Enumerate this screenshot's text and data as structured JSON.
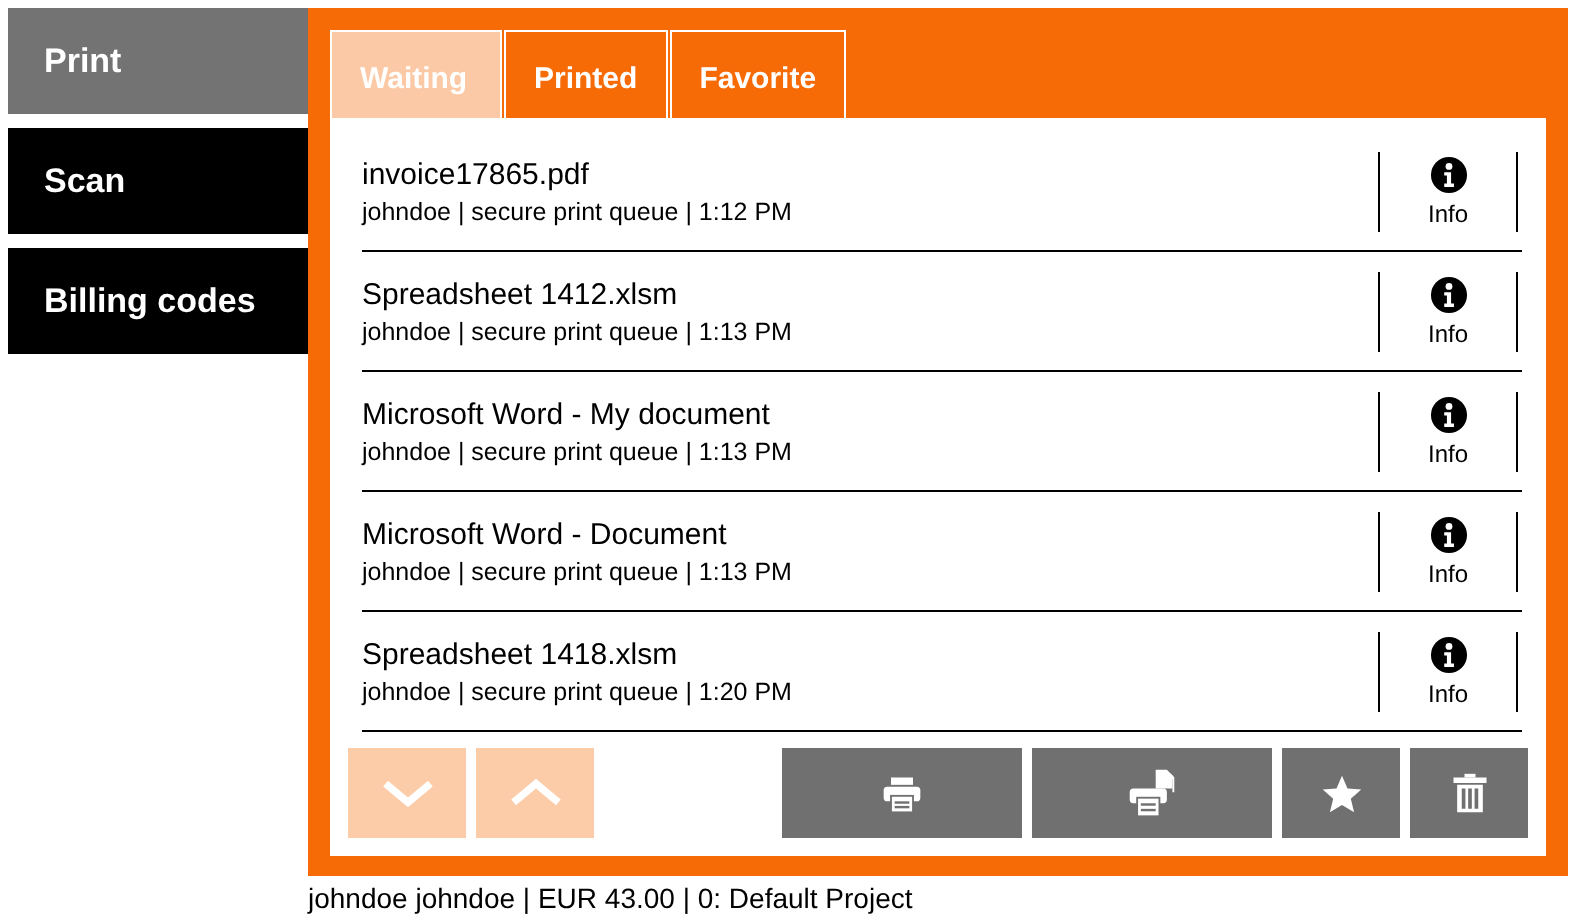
{
  "sidebar": {
    "items": [
      {
        "label": "Print",
        "selected": true
      },
      {
        "label": "Scan",
        "selected": false
      },
      {
        "label": "Billing codes",
        "selected": false
      }
    ]
  },
  "tabs": [
    {
      "label": "Waiting",
      "selected": true
    },
    {
      "label": "Printed",
      "selected": false
    },
    {
      "label": "Favorite",
      "selected": false
    }
  ],
  "jobs": [
    {
      "name": "invoice17865.pdf",
      "details": "johndoe | secure print queue | 1:12 PM",
      "action": "Info"
    },
    {
      "name": "Spreadsheet 1412.xlsm",
      "details": "johndoe | secure print queue | 1:13 PM",
      "action": "Info"
    },
    {
      "name": "Microsoft Word - My document",
      "details": "johndoe | secure print queue | 1:13 PM",
      "action": "Info"
    },
    {
      "name": "Microsoft Word - Document",
      "details": "johndoe | secure print queue | 1:13 PM",
      "action": "Info"
    },
    {
      "name": "Spreadsheet 1418.xlsm",
      "details": "johndoe | secure print queue | 1:20 PM",
      "action": "Info"
    }
  ],
  "scroll_buttons": [
    {
      "kind": "down",
      "disabled": true
    },
    {
      "kind": "up",
      "disabled": true
    }
  ],
  "action_buttons": [
    {
      "kind": "print"
    },
    {
      "kind": "print-copies"
    },
    {
      "kind": "favorite"
    },
    {
      "kind": "delete"
    }
  ],
  "status_bar": "johndoe johndoe | EUR 43.00 | 0: Default Project"
}
